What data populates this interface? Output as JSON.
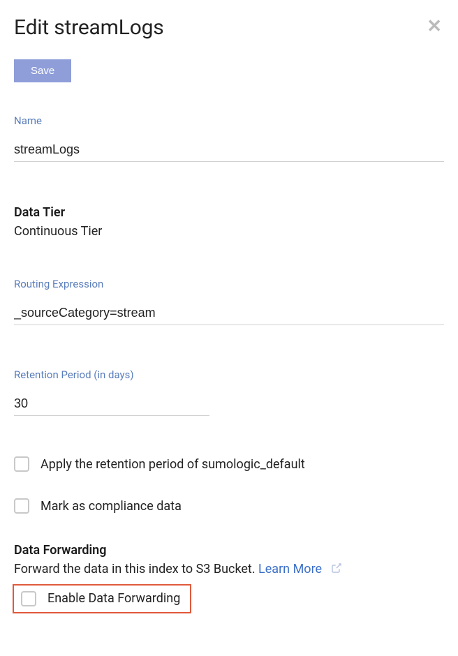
{
  "title": "Edit streamLogs",
  "save_label": "Save",
  "close_icon": "✕",
  "name": {
    "label": "Name",
    "value": "streamLogs"
  },
  "data_tier": {
    "heading": "Data Tier",
    "value": "Continuous Tier"
  },
  "routing": {
    "label": "Routing Expression",
    "value": "_sourceCategory=stream"
  },
  "retention": {
    "label": "Retention Period (in days)",
    "value": "30"
  },
  "apply_default_label": "Apply the retention period of sumologic_default",
  "compliance_label": "Mark as compliance data",
  "forwarding": {
    "heading": "Data Forwarding",
    "description": "Forward the data in this index to S3 Bucket. ",
    "learn_more": "Learn More",
    "enable_label": "Enable Data Forwarding"
  }
}
